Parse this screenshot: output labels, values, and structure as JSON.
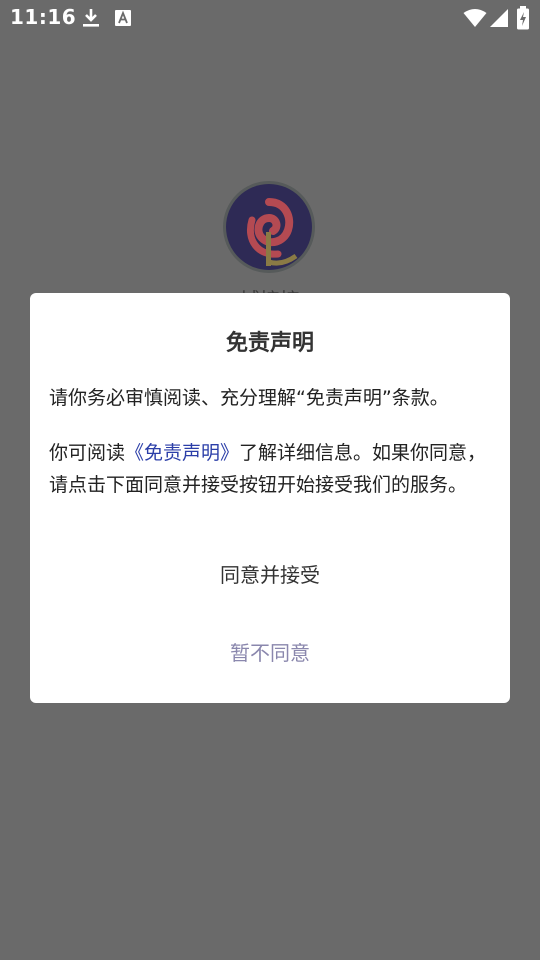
{
  "status_bar": {
    "time": "11:16",
    "icons": [
      "download-icon",
      "a-notification-icon",
      "wifi-icon",
      "signal-icon",
      "battery-icon"
    ]
  },
  "app": {
    "name": "城接接"
  },
  "dialog": {
    "title": "免责声明",
    "para1": "请你务必审慎阅读、充分理解“免责声明”条款。",
    "para2_prefix": "你可阅读",
    "para2_link": "《免责声明》",
    "para2_suffix": "了解详细信息。如果你同意，请点击下面同意并接受按钮开始接受我们的服务。",
    "accept_label": "同意并接受",
    "decline_label": "暂不同意"
  },
  "colors": {
    "overlay": "#6a6a6a",
    "link": "#2b3ea8",
    "decline": "#8a87ad"
  }
}
